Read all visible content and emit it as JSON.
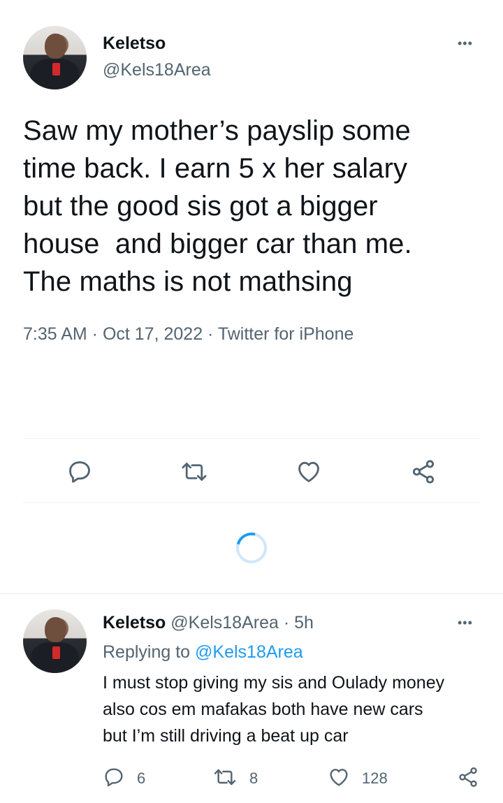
{
  "main_tweet": {
    "author_name": "Keletso",
    "author_handle": "@Kels18Area",
    "more_label": "•••",
    "text_lines": [
      "Saw my mother’s payslip some",
      "time back. I earn 5 x her salary",
      "but the good sis got a bigger",
      "house  and bigger car than me.",
      "The maths is not mathsing"
    ],
    "meta": "7:35 AM · Oct 17, 2022 · Twitter for iPhone"
  },
  "reply_tweet": {
    "author_name": "Keletso",
    "author_handle": "@Kels18Area",
    "separator": "·",
    "age": "5h",
    "more_label": "•••",
    "replying_prefix": "Replying to",
    "replying_handle": "@Kels18Area",
    "text_lines": [
      "I must stop giving my sis and Oulady money",
      "also cos em mafakas both have new cars",
      "but I’m still driving a beat up car"
    ],
    "reply_count": "6",
    "retweet_count": "8",
    "like_count": "128"
  },
  "icons": {
    "reply": "reply-icon",
    "retweet": "retweet-icon",
    "like": "heart-icon",
    "share": "share-icon",
    "loading": "loading-spinner"
  },
  "colors": {
    "text": "#0f1419",
    "secondary": "#536471",
    "accent": "#1d9bf0",
    "divider": "#eff3f4"
  }
}
